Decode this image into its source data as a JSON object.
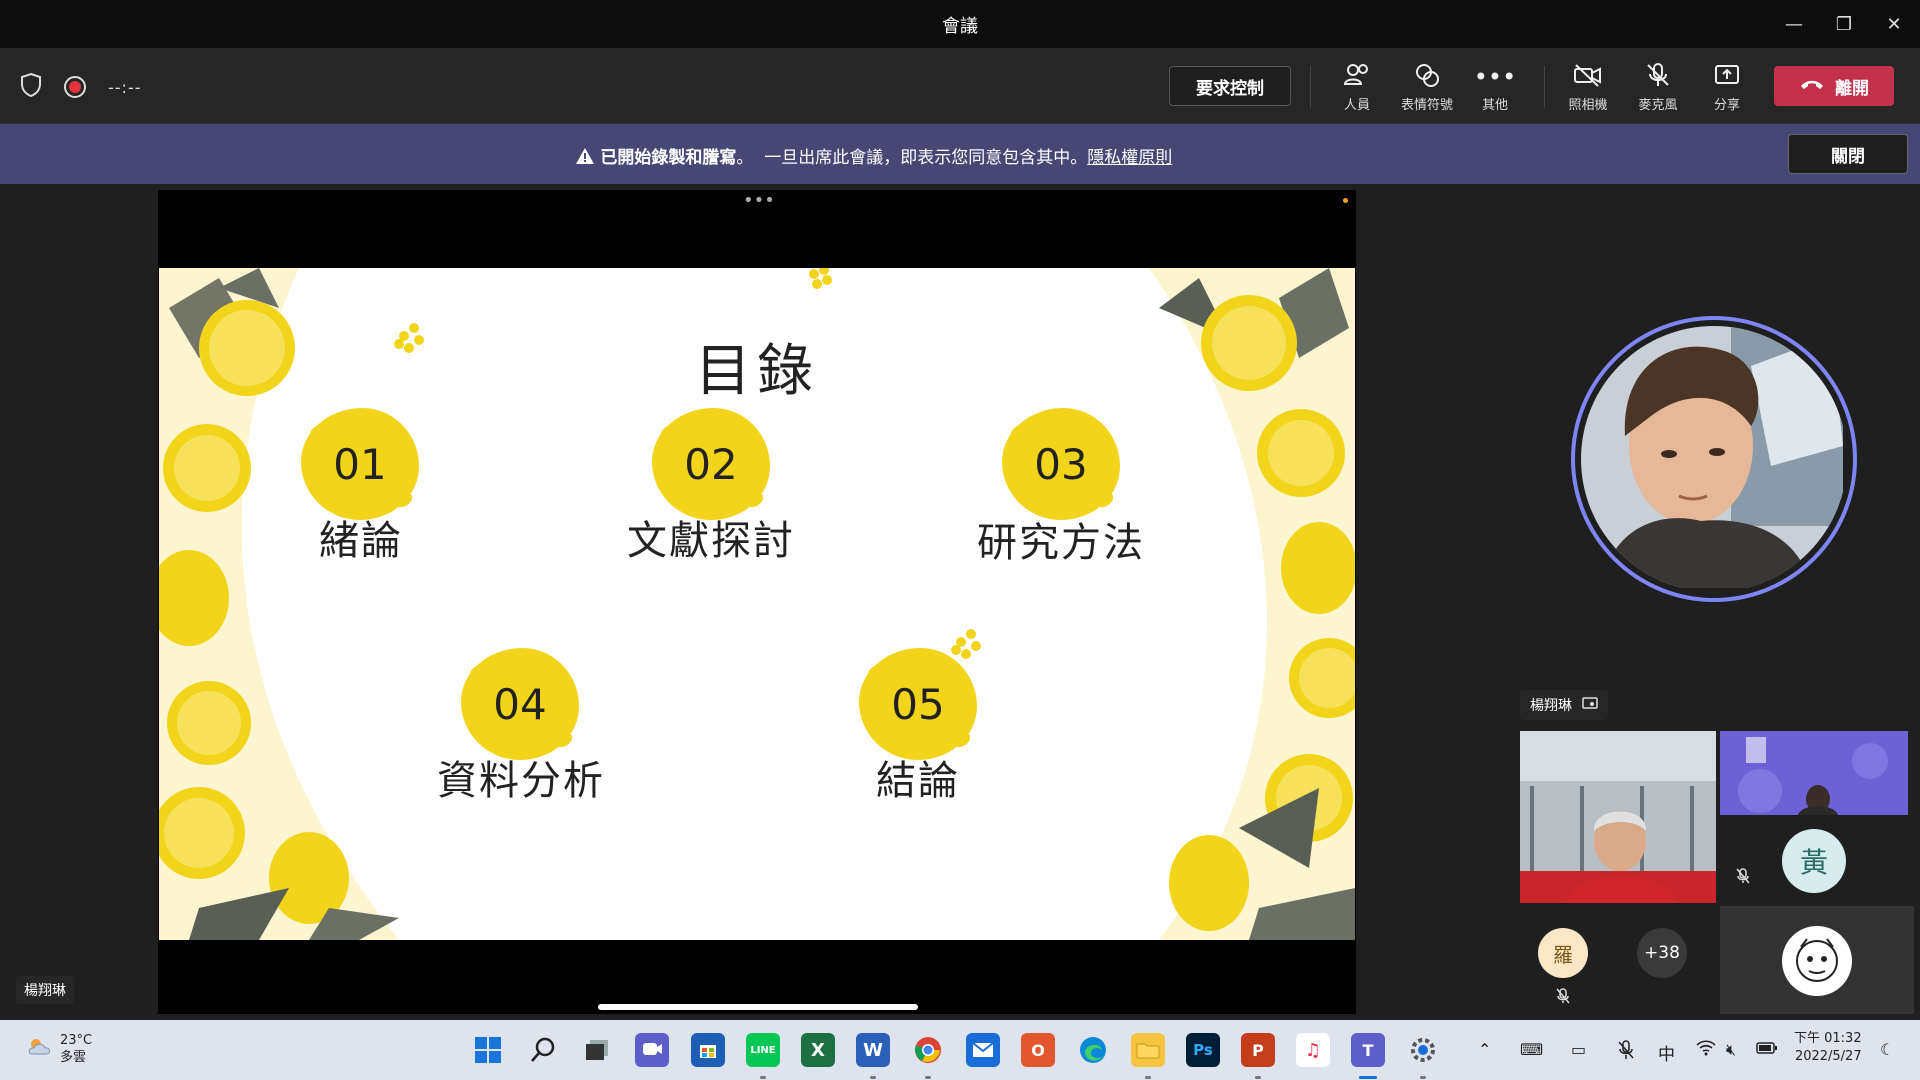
{
  "window": {
    "title": "會議",
    "minimize": "—",
    "restore": "❐",
    "close": "✕"
  },
  "toolbar": {
    "timer": "--:--",
    "request_control": "要求控制",
    "people": "人員",
    "reactions": "表情符號",
    "more": "其他",
    "camera": "照相機",
    "mic": "麥克風",
    "share": "分享",
    "leave": "離開"
  },
  "banner": {
    "bold": "已開始錄製和謄寫",
    "dot": "。",
    "text": "一旦出席此會議，即表示您同意包含其中。",
    "link": "隱私權原則",
    "close": "關閉"
  },
  "stage": {
    "presenter_name": "楊翔琳",
    "more_dots": "•••",
    "slide": {
      "title": "目錄",
      "items": [
        {
          "num": "01",
          "label": "緒論"
        },
        {
          "num": "02",
          "label": "文獻探討"
        },
        {
          "num": "03",
          "label": "研究方法"
        },
        {
          "num": "04",
          "label": "資料分析"
        },
        {
          "num": "05",
          "label": "結論"
        }
      ]
    }
  },
  "participants": {
    "speaker_name": "楊翔琳",
    "huang_initial": "黃",
    "luo_initial": "羅",
    "more_count": "+38"
  },
  "taskbar": {
    "temp": "23°C",
    "weather": "多雲",
    "ime": "中",
    "time": "下午 01:32",
    "date": "2022/5/27"
  }
}
